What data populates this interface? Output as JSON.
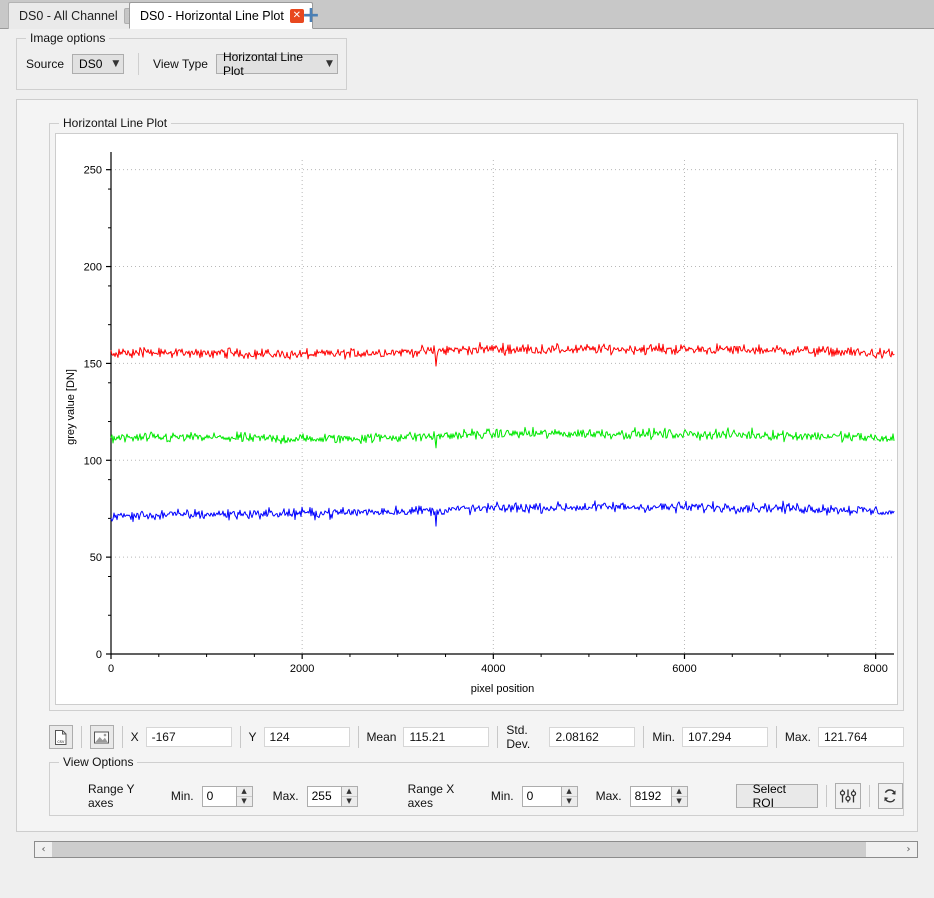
{
  "window": {
    "tabs": [
      {
        "label": "DS0 - All Channel",
        "active": false,
        "close_icon": "close-icon"
      },
      {
        "label": "DS0 - Horizontal Line Plot",
        "active": true,
        "close_icon": "close-icon"
      }
    ],
    "add_tab_label": "+"
  },
  "image_options": {
    "title": "Image options",
    "source_label": "Source",
    "source_value": "DS0",
    "view_type_label": "View Type",
    "view_type_value": "Horizontal Line Plot",
    "caret": "⌄"
  },
  "plot_panel": {
    "title": "Horizontal Line Plot"
  },
  "readout": {
    "csv_button": "csv",
    "image_button": "image",
    "x_label": "X",
    "x_value": "-167",
    "y_label": "Y",
    "y_value": "124",
    "mean_label": "Mean",
    "mean_value": "115.21",
    "std_label": "Std. Dev.",
    "std_value": "2.08162",
    "min_label": "Min.",
    "min_value": "107.294",
    "max_label": "Max.",
    "max_value": "121.764"
  },
  "view_options": {
    "title": "View Options",
    "range_y_label": "Range Y axes",
    "y_min_label": "Min.",
    "y_min_value": "0",
    "y_max_label": "Max.",
    "y_max_value": "255",
    "range_x_label": "Range X axes",
    "x_min_label": "Min.",
    "x_min_value": "0",
    "x_max_label": "Max.",
    "x_max_value": "8192",
    "select_roi_label": "Select ROI",
    "spin_up": "▲",
    "spin_down": "▼"
  },
  "scrollbar": {
    "left_arrow": "‹",
    "right_arrow": "›"
  },
  "chart_data": {
    "type": "line",
    "title": "Horizontal Line Plot",
    "xlabel": "pixel position",
    "ylabel": "grey value [DN]",
    "xlim": [
      0,
      8192
    ],
    "ylim": [
      0,
      255
    ],
    "xticks": [
      0,
      2000,
      4000,
      6000,
      8000
    ],
    "xtick_labels": [
      "0",
      "2000",
      "4000",
      "6000",
      "8000"
    ],
    "yticks": [
      0,
      50,
      100,
      150,
      200,
      250
    ],
    "ytick_labels": [
      "0",
      "50",
      "100",
      "150",
      "200",
      "250"
    ],
    "grid": true,
    "minor_tick_spacing_y": 10,
    "minor_tick_spacing_x": 500,
    "legend": "none",
    "noise_amplitude": 2.1,
    "spike": {
      "x": 3400,
      "depth": 12,
      "comment": "sharp downward dropout present in all three channels"
    },
    "series": [
      {
        "name": "Red channel",
        "color": "#FF0000",
        "x": [
          0,
          400,
          800,
          1200,
          1600,
          2000,
          2400,
          2800,
          3200,
          3400,
          3600,
          4000,
          4200,
          4600,
          5000,
          5400,
          5800,
          6200,
          6600,
          7000,
          7400,
          7800,
          8192
        ],
        "values": [
          155.0,
          155.6,
          155.8,
          155.4,
          154.8,
          154.6,
          155.0,
          155.6,
          156.2,
          156.4,
          157.0,
          157.6,
          157.2,
          157.1,
          157.3,
          157.4,
          157.3,
          157.2,
          157.0,
          156.8,
          156.3,
          155.6,
          154.6
        ]
      },
      {
        "name": "Green channel",
        "color": "#00E800",
        "x": [
          0,
          400,
          800,
          1200,
          1600,
          2000,
          2400,
          2800,
          3200,
          3400,
          3600,
          4000,
          4200,
          4600,
          5000,
          5400,
          5800,
          6200,
          6600,
          7000,
          7400,
          7800,
          8192
        ],
        "values": [
          111.4,
          111.6,
          111.8,
          111.6,
          111.2,
          111.0,
          111.2,
          111.7,
          112.3,
          112.6,
          113.0,
          113.6,
          113.8,
          113.7,
          113.8,
          113.7,
          113.5,
          113.4,
          113.2,
          112.9,
          112.5,
          111.9,
          110.9
        ]
      },
      {
        "name": "Blue channel",
        "color": "#0000FF",
        "x": [
          0,
          400,
          800,
          1200,
          1600,
          2000,
          2400,
          2800,
          3200,
          3400,
          3600,
          4000,
          4200,
          4600,
          5000,
          5400,
          5800,
          6200,
          6600,
          7000,
          7400,
          7800,
          8192
        ],
        "values": [
          71.0,
          71.6,
          72.0,
          72.2,
          72.4,
          72.6,
          73.0,
          73.6,
          74.0,
          74.2,
          74.6,
          75.2,
          75.5,
          75.6,
          75.8,
          75.9,
          75.8,
          75.8,
          75.7,
          75.4,
          75.0,
          74.3,
          73.0
        ]
      }
    ]
  }
}
